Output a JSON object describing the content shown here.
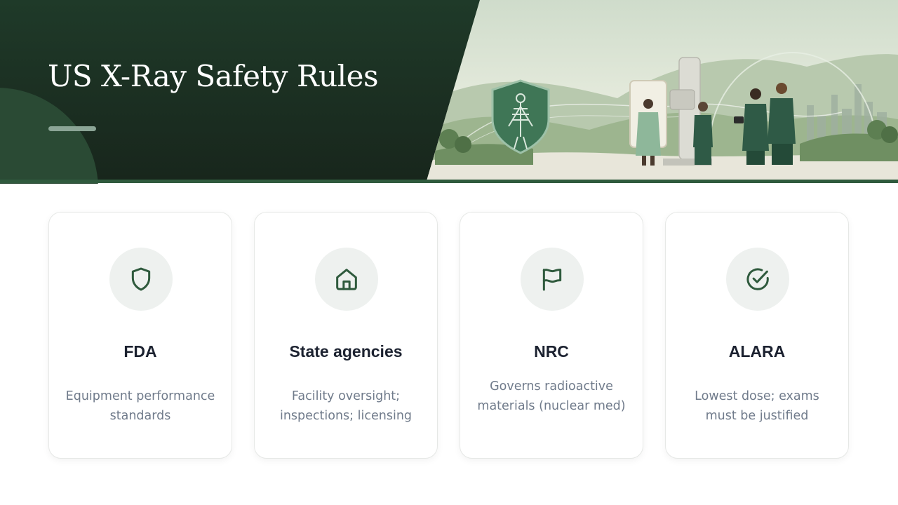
{
  "header": {
    "title": "US X-Ray Safety Rules"
  },
  "colors": {
    "dark_green": "#1f3a29",
    "accent_green": "#2f5a3d",
    "icon_green": "#2f5a3d",
    "card_title": "#1c2230",
    "card_desc": "#707b8b"
  },
  "cards": [
    {
      "icon": "shield-icon",
      "title": "FDA",
      "description": "Equipment performance standards"
    },
    {
      "icon": "home-icon",
      "title": "State agencies",
      "description": "Facility oversight; inspections; licensing"
    },
    {
      "icon": "flag-icon",
      "title": "NRC",
      "description": "Governs radioactive materials (nuclear med)"
    },
    {
      "icon": "check-circle-icon",
      "title": "ALARA",
      "description": "Lowest dose; exams must be justified"
    }
  ]
}
